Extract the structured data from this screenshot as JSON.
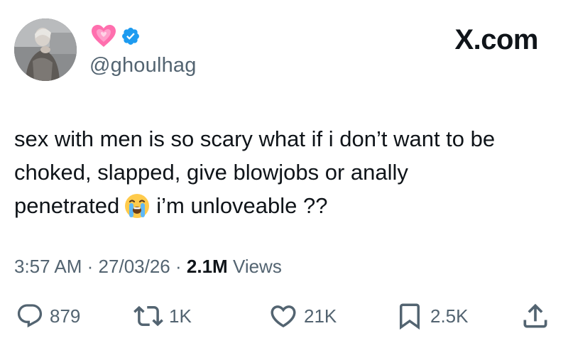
{
  "header": {
    "brand": "X.com",
    "handle": "@ghoulhag",
    "name_emoji": "growing-heart-emoji",
    "verified_color": "#1d9bf0"
  },
  "tweet": {
    "lines": [
      "sex with men is so scary what if i don’t want to be",
      "choked, slapped, give blowjobs or anally",
      "penetrated",
      "i’m unloveable ??"
    ],
    "inline_emoji": "loudly-crying-face-emoji"
  },
  "meta": {
    "time": "3:57 AM",
    "sep1": "·",
    "date": "27/03/26",
    "sep2": "·",
    "views_count": "2.1M",
    "views_label": "Views"
  },
  "actions": {
    "replies": "879",
    "reposts": "1K",
    "likes": "21K",
    "bookmarks": "2.5K"
  },
  "colors": {
    "text": "#0f1419",
    "secondary": "#536471",
    "verified": "#1d9bf0",
    "heart_emoji": "#ff6fae"
  }
}
